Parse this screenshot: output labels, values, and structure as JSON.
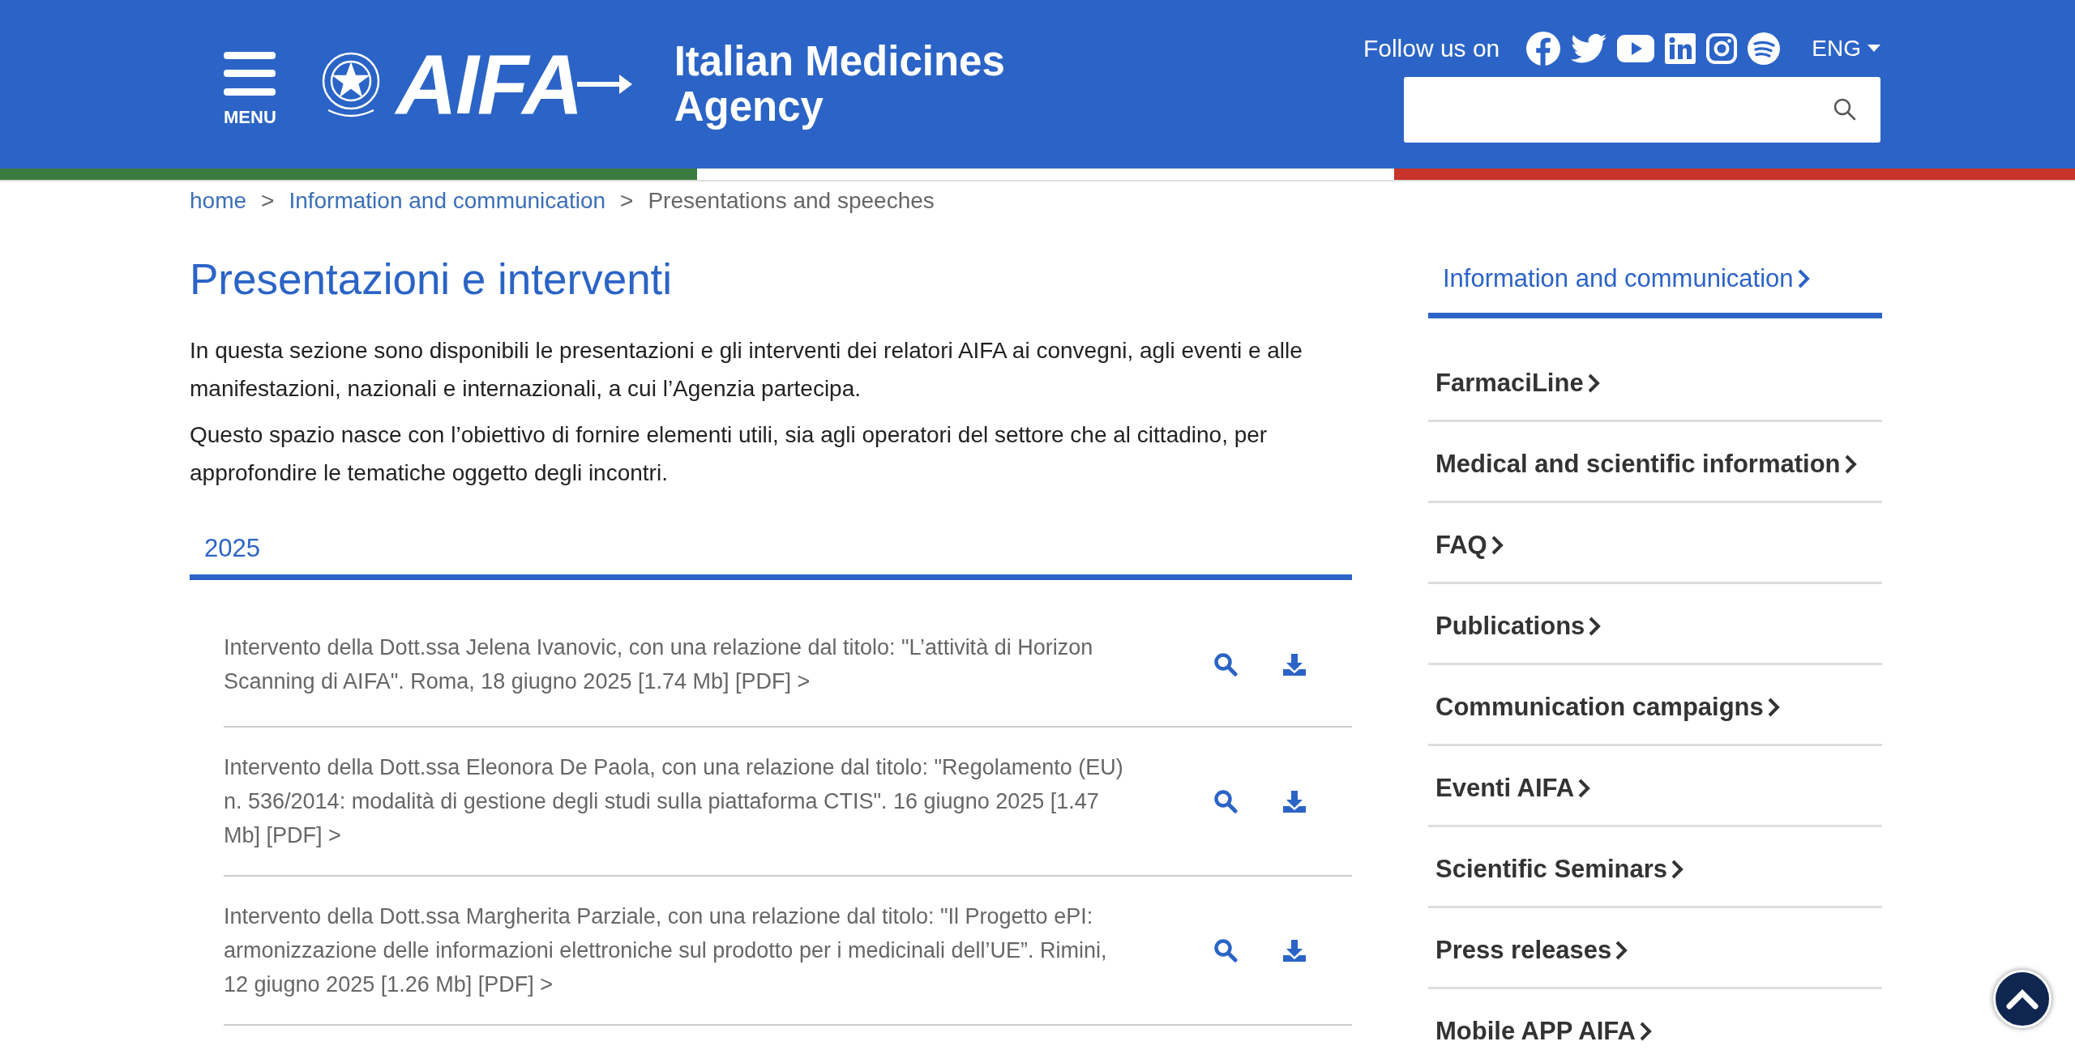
{
  "header": {
    "menu_label": "MENU",
    "logo_text": "AIFA",
    "title_lines": [
      "Italian Medicines",
      "Agency"
    ],
    "follow_label": "Follow us on",
    "language": "ENG"
  },
  "breadcrumbs": [
    {
      "label": "home",
      "kind": "link"
    },
    {
      "label": "Information and communication",
      "kind": "link"
    },
    {
      "label": "Presentations and speeches",
      "kind": "current"
    }
  ],
  "breadcrumb_separator": ">",
  "page_title": "Presentazioni e interventi",
  "paragraphs": [
    "In questa sezione sono disponibili le presentazioni e gli interventi dei relatori AIFA ai convegni, agli eventi e alle manifestazioni, nazionali e internazionali, a cui l’Agenzia partecipa.",
    "Questo spazio nasce con l’obiettivo di fornire elementi utili, sia agli operatori del settore che al cittadino, per approfondire le tematiche oggetto degli incontri."
  ],
  "year_tabs": [
    {
      "label": "2025",
      "selected": true
    }
  ],
  "documents": [
    {
      "text": "Intervento della Dott.ssa Jelena Ivanovic, con una relazione dal titolo: \"L’attività di Horizon Scanning di AIFA\". Roma, 18 giugno 2025 [1.74 Mb] [PDF] >"
    },
    {
      "text": "Intervento della Dott.ssa Eleonora De Paola, con una relazione dal titolo: \"Regolamento (EU) n. 536/2014: modalità di gestione degli studi sulla piattaforma CTIS\". 16 giugno 2025 [1.47 Mb] [PDF] >"
    },
    {
      "text": "Intervento della Dott.ssa Margherita Parziale, con una relazione dal titolo: \"Il Progetto ePI: armonizzazione delle informazioni elettroniche sul prodotto per i medicinali dell’UE”. Rimini, 12 giugno 2025 [1.26 Mb] [PDF] >"
    }
  ],
  "sidebar": {
    "items": [
      {
        "label": "Information and communication",
        "selected": true
      },
      {
        "label": "FarmaciLine",
        "selected": false
      },
      {
        "label": "Medical and scientific information",
        "selected": false
      },
      {
        "label": "FAQ",
        "selected": false
      },
      {
        "label": "Publications",
        "selected": false
      },
      {
        "label": "Communication campaigns",
        "selected": false
      },
      {
        "label": "Eventi AIFA",
        "selected": false
      },
      {
        "label": "Scientific Seminars",
        "selected": false
      },
      {
        "label": "Press releases",
        "selected": false
      },
      {
        "label": "Mobile APP AIFA",
        "selected": false
      }
    ]
  }
}
